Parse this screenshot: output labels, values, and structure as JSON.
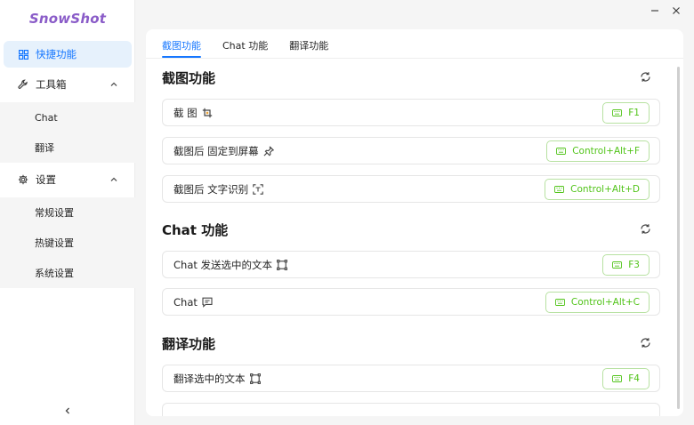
{
  "app": {
    "logo": "SnowShot"
  },
  "sidebar": {
    "items": [
      {
        "label": "快捷功能",
        "icon": "grid-icon",
        "active": true
      },
      {
        "label": "工具箱",
        "icon": "wrench-icon",
        "expanded": true,
        "children": [
          "Chat",
          "翻译"
        ]
      },
      {
        "label": "设置",
        "icon": "gear-icon",
        "expanded": true,
        "children": [
          "常规设置",
          "热键设置",
          "系统设置"
        ]
      }
    ]
  },
  "tabs": [
    "截图功能",
    "Chat 功能",
    "翻译功能"
  ],
  "active_tab": 0,
  "sections": [
    {
      "title": "截图功能",
      "rows": [
        {
          "label": "截 图",
          "icon": "crop-icon",
          "key": "F1"
        },
        {
          "label": "截图后 固定到屏幕",
          "icon": "pin-icon",
          "key": "Control+Alt+F"
        },
        {
          "label": "截图后 文字识别",
          "icon": "scan-text-icon",
          "key": "Control+Alt+D"
        }
      ]
    },
    {
      "title": "Chat 功能",
      "rows": [
        {
          "label": "Chat 发送选中的文本",
          "icon": "select-text-icon",
          "key": "F3"
        },
        {
          "label": "Chat",
          "icon": "message-icon",
          "key": "Control+Alt+C"
        }
      ]
    },
    {
      "title": "翻译功能",
      "rows": [
        {
          "label": "翻译选中的文本",
          "icon": "select-text-icon",
          "key": "F4"
        }
      ]
    }
  ],
  "colors": {
    "accent": "#1677ff",
    "key_green": "#52c41a",
    "logo": "#8a5cc8"
  }
}
